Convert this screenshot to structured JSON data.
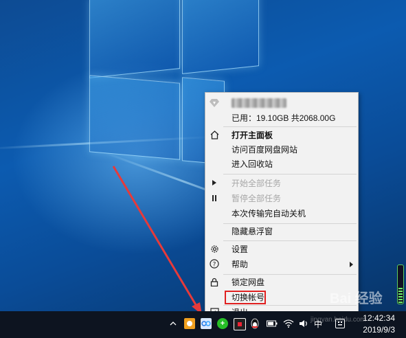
{
  "menu": {
    "account_name": "",
    "usage": "已用：19.10GB  共2068.00G",
    "items": [
      {
        "label": "打开主面板",
        "icon": "home-icon"
      },
      {
        "label": "访问百度网盘网站"
      },
      {
        "label": "进入回收站"
      },
      {
        "label": "开始全部任务",
        "icon": "play-icon",
        "disabled": true
      },
      {
        "label": "暂停全部任务",
        "icon": "pause-icon",
        "disabled": true
      },
      {
        "label": "本次传输完自动关机"
      },
      {
        "label": "隐藏悬浮窗"
      },
      {
        "label": "设置",
        "icon": "gear-icon"
      },
      {
        "label": "帮助",
        "icon": "help-icon",
        "has_submenu": true
      },
      {
        "label": "锁定网盘",
        "icon": "lock-icon"
      },
      {
        "label": "切换帐号",
        "highlighted": true
      },
      {
        "label": "退出",
        "icon": "exit-icon"
      }
    ]
  },
  "taskbar": {
    "time": "12:42:34",
    "date": "2019/9/3",
    "ime_label": "中",
    "tray_icons": [
      "chevron-up-icon",
      "baidu-netdisk-icon",
      "cloud-icon",
      "plus-green-icon",
      "app-icon",
      "penguin-icon",
      "battery-icon",
      "wifi-icon",
      "volume-icon",
      "ime-icon",
      "notification-icon"
    ]
  },
  "watermark": {
    "text": "Bai 经验",
    "sub": "jingyan.baidu.com"
  },
  "colors": {
    "annotation_red": "#e02020",
    "menu_bg": "#f2f2f2",
    "taskbar_bg": "#0d1420"
  }
}
